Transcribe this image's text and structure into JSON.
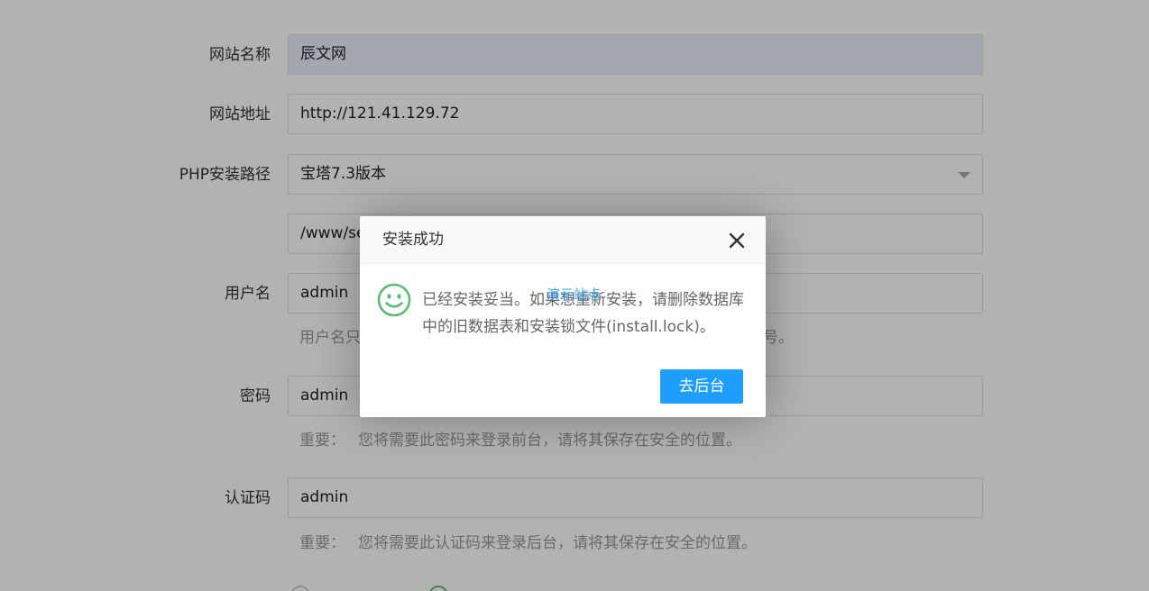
{
  "form": {
    "site_name": {
      "label": "网站名称",
      "value": "辰文网"
    },
    "site_url": {
      "label": "网站地址",
      "value": "http://121.41.129.72"
    },
    "php_path": {
      "label": "PHP安装路径",
      "selected": "宝塔7.3版本",
      "path_value": "/www/se"
    },
    "username": {
      "label": "用户名",
      "value": "admin",
      "hint_start": "用户名只",
      "hint_end": "号。"
    },
    "password": {
      "label": "密码",
      "value": "admin",
      "hint_prefix": "重要：",
      "hint": "您将需要此密码来登录前台，请将其保存在安全的位置。"
    },
    "auth_code": {
      "label": "认证码",
      "value": "admin",
      "hint_prefix": "重要：",
      "hint": "您将需要此认证码来登录后台，请将其保存在安全的位置。"
    }
  },
  "dialog": {
    "title": "安装成功",
    "icon": "smile-icon",
    "message": "已经安装妥当。如果想重新安装，请删除数据库中的旧数据表和安装锁文件(install.lock)。",
    "ghost_link": "演示站点",
    "button_label": "去后台",
    "close_icon": "close-icon"
  },
  "colors": {
    "accent": "#1E9FFF",
    "success": "#5FB878",
    "autofill_bg": "#e8f0fe"
  }
}
